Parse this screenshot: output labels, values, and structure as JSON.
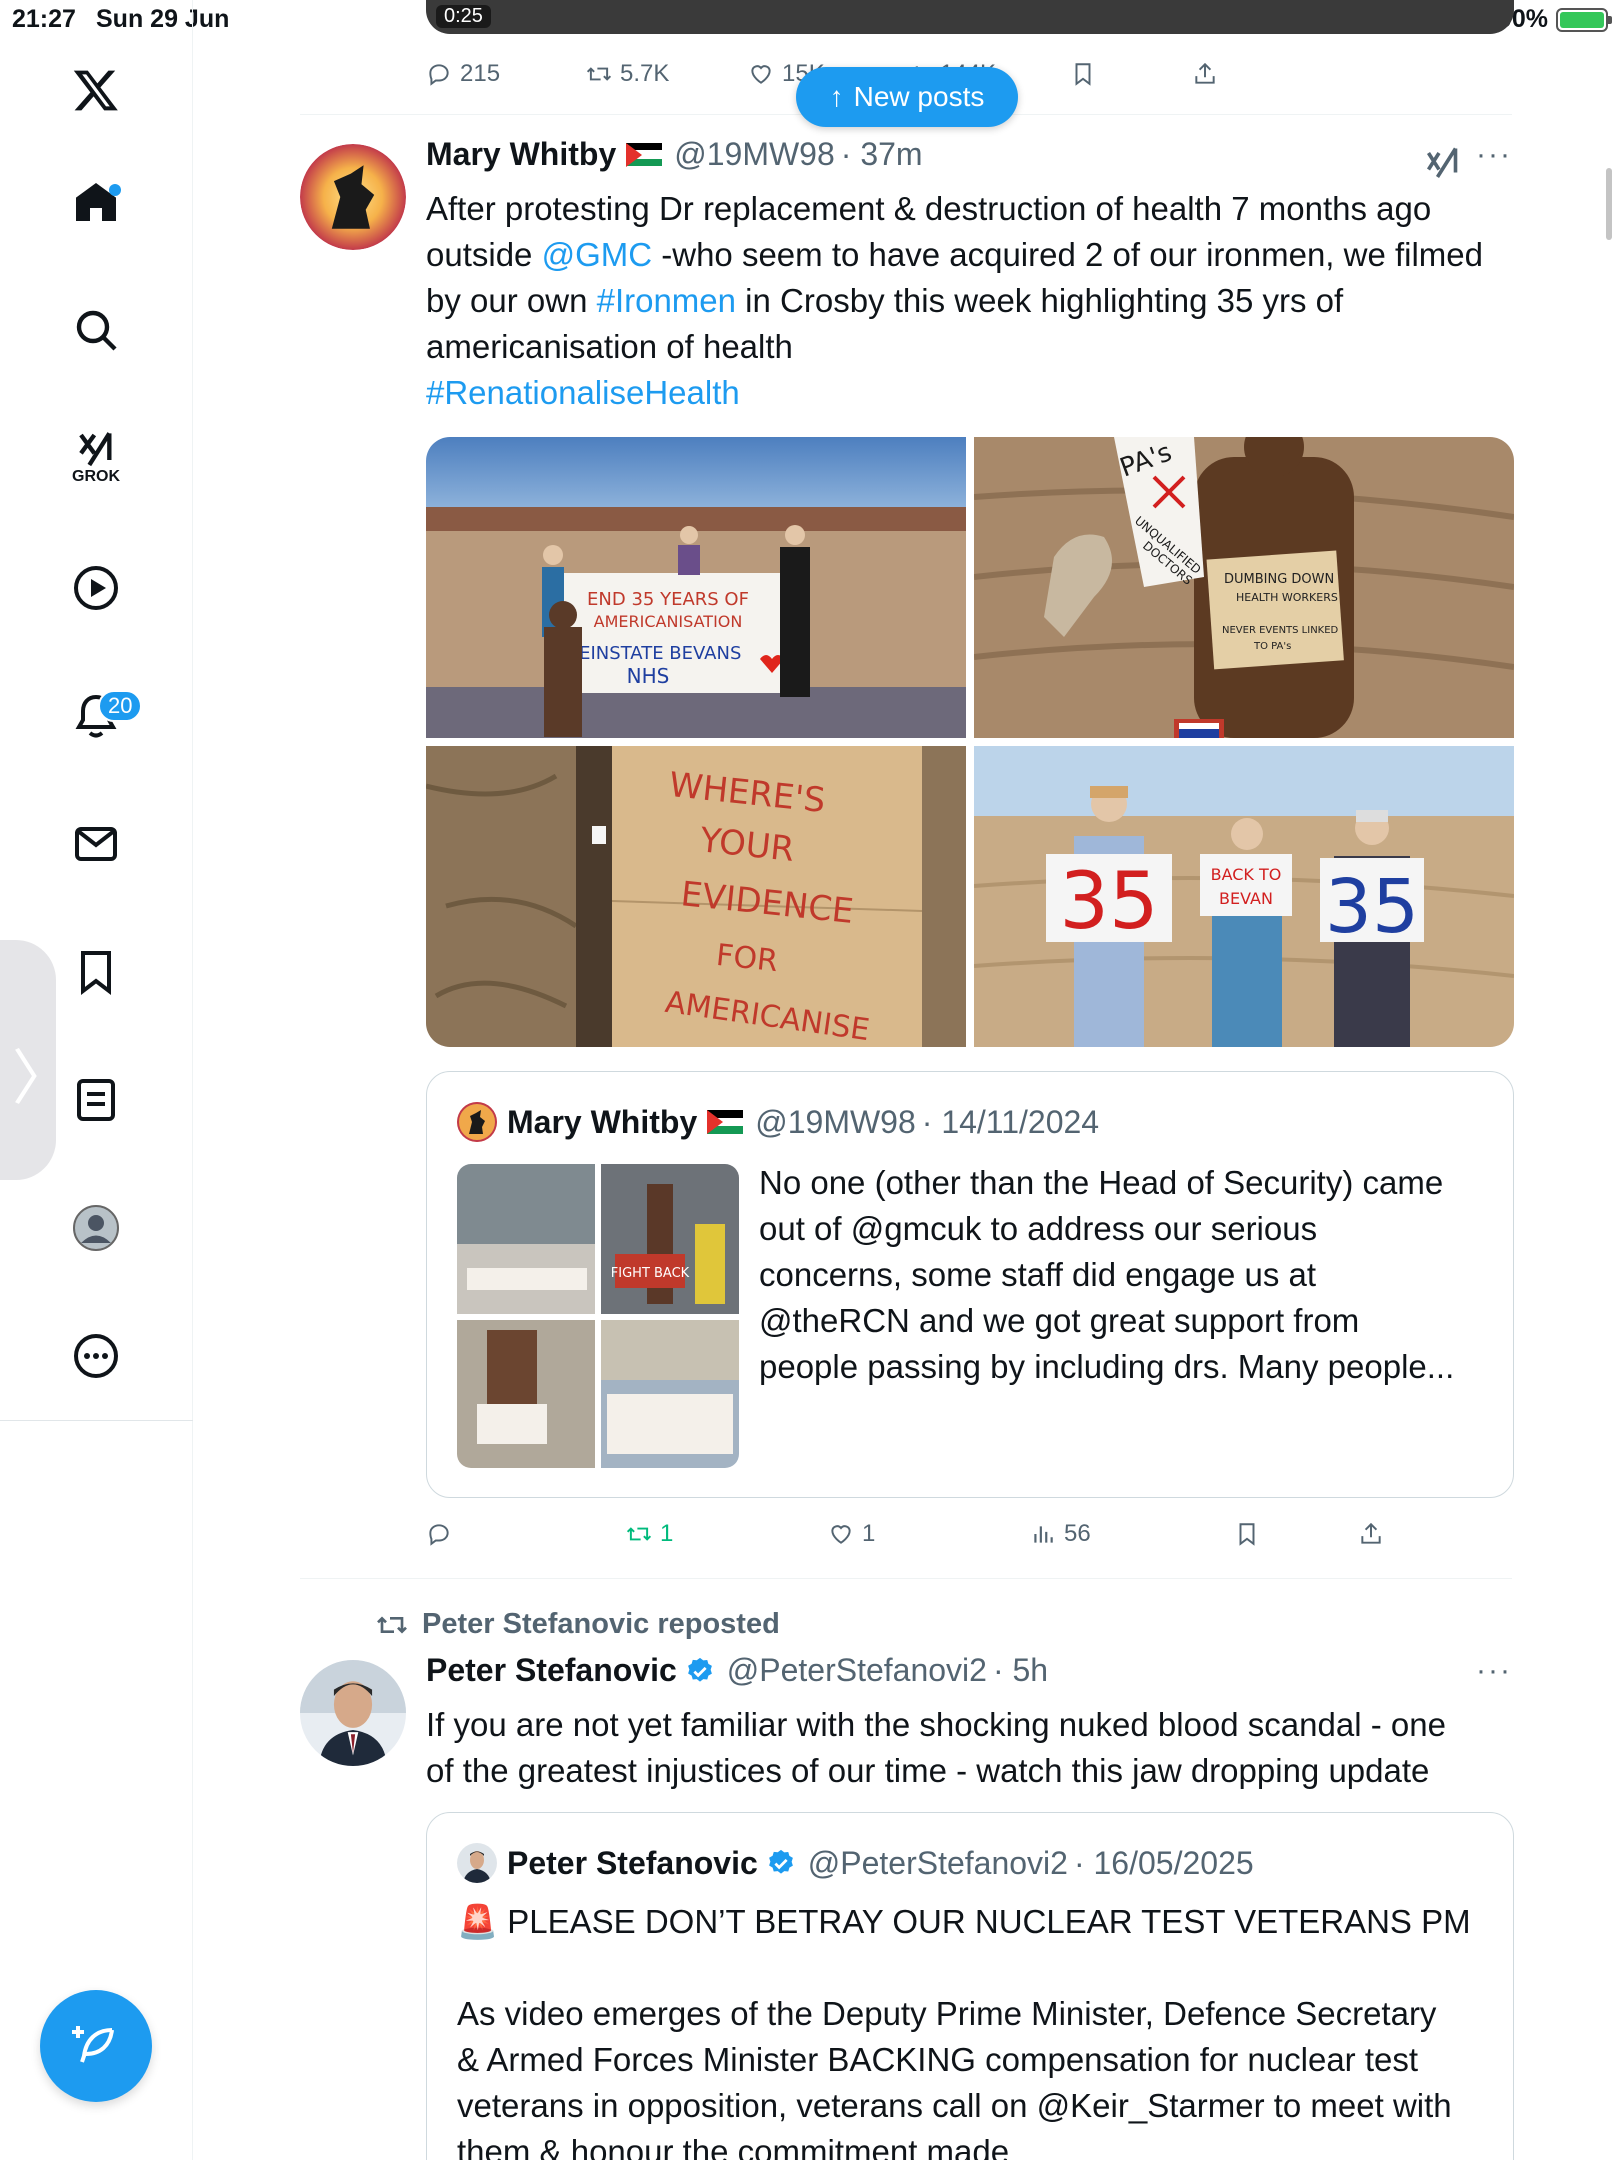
{
  "status_bar": {
    "time": "21:27",
    "date": "Sun 29 Jun",
    "battery": "100%"
  },
  "sidebar": {
    "grok_label": "GROK",
    "notifications_badge": "20",
    "items": [
      "home",
      "search",
      "grok",
      "video",
      "notifications",
      "messages",
      "bookmarks",
      "lists",
      "profile",
      "more"
    ]
  },
  "new_posts_label": "New posts",
  "prev_post": {
    "media_label": "0:25",
    "replies": "215",
    "reposts": "5.7K",
    "likes": "15K",
    "views": "144K"
  },
  "post1": {
    "name": "Mary Whitby",
    "handle": "@19MW98",
    "time": "· 37m",
    "text": {
      "l1": "After protesting Dr replacement & destruction of health 7 months ago",
      "l2a": "outside ",
      "l2_mention": "@GMC",
      "l2b": " -who seem to have acquired 2 of our ironmen, we filmed",
      "l3a": "by our own ",
      "l3_tag": "#Ironmen",
      "l3b": " in Crosby this week highlighting 35 yrs of",
      "l4": "americanisation of health",
      "l5_tag": "#RenationaliseHealth"
    },
    "images": {
      "img1_banner": [
        "END 35 YEARS OF",
        "AMERICANISATION",
        "REINSTATE BEVANS",
        "NHS"
      ],
      "img2_signs": [
        "PA's",
        "UNQUALIFIED",
        "DOCTORS",
        "DUMBING DOWN",
        "HEALTH WORKERS",
        "NEVER EVENTS LINKED",
        "TO PA's"
      ],
      "img3_sign": [
        "WHERE'S",
        "YOUR",
        "EVIDENCE",
        "FOR",
        "AMERICANISE"
      ],
      "img4_signs": [
        "35",
        "BACK TO",
        "BEVAN",
        "35"
      ]
    },
    "quote": {
      "name": "Mary Whitby",
      "handle": "@19MW98",
      "time": "· 14/11/2024",
      "lines": [
        "No one (other than the Head of Security) came",
        "out of @gmcuk to address our serious",
        "concerns, some staff did engage us at",
        "@theRCN and we got great support from",
        "people passing by including drs. Many people..."
      ],
      "img_sign": "FIGHT BACK"
    },
    "replies": "",
    "reposts": "1",
    "likes": "1",
    "views": "56"
  },
  "post2": {
    "repost_by": "Peter Stefanovic reposted",
    "name": "Peter Stefanovic",
    "handle": "@PeterStefanovi2",
    "time": "· 5h",
    "lines": [
      "If you are not yet familiar with the shocking nuked blood scandal - one",
      "of the greatest injustices of our time - watch this jaw dropping update"
    ],
    "quote": {
      "name": "Peter Stefanovic",
      "handle": "@PeterStefanovi2",
      "time": "· 16/05/2025",
      "headline": "🚨 PLEASE DON’T BETRAY OUR NUCLEAR TEST VETERANS PM",
      "lines": [
        "As video emerges of the Deputy Prime Minister, Defence Secretary",
        "& Armed Forces Minister BACKING compensation for nuclear test",
        "veterans in opposition, veterans call on @Keir_Starmer to meet with",
        "them & honour the commitment made"
      ]
    }
  },
  "colors": {
    "accent": "#1d9bf0",
    "repost_green": "#00ba7c",
    "muted": "#536471"
  }
}
